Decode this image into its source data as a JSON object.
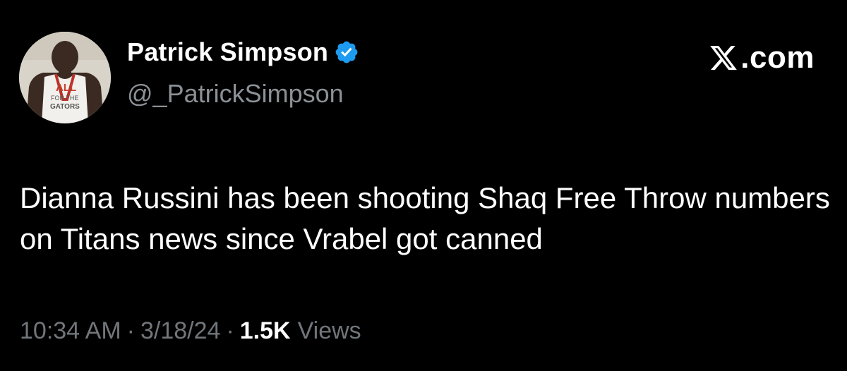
{
  "author": {
    "display_name": "Patrick Simpson",
    "handle": "@_PatrickSimpson",
    "avatar_shirt_text": "ALL FOR THE GATORS"
  },
  "brand": {
    "label": ".com",
    "icon": "x-logo-icon"
  },
  "tweet": {
    "text": "Dianna Russini has been shooting Shaq Free Throw numbers on Titans news since Vrabel got canned"
  },
  "meta": {
    "time": "10:34 AM",
    "date": "3/18/24",
    "separator": "·",
    "views_count": "1.5K",
    "views_label": "Views"
  },
  "colors": {
    "background": "#000000",
    "verified_badge": "#1d9bf0",
    "secondary_text": "#71767b"
  }
}
